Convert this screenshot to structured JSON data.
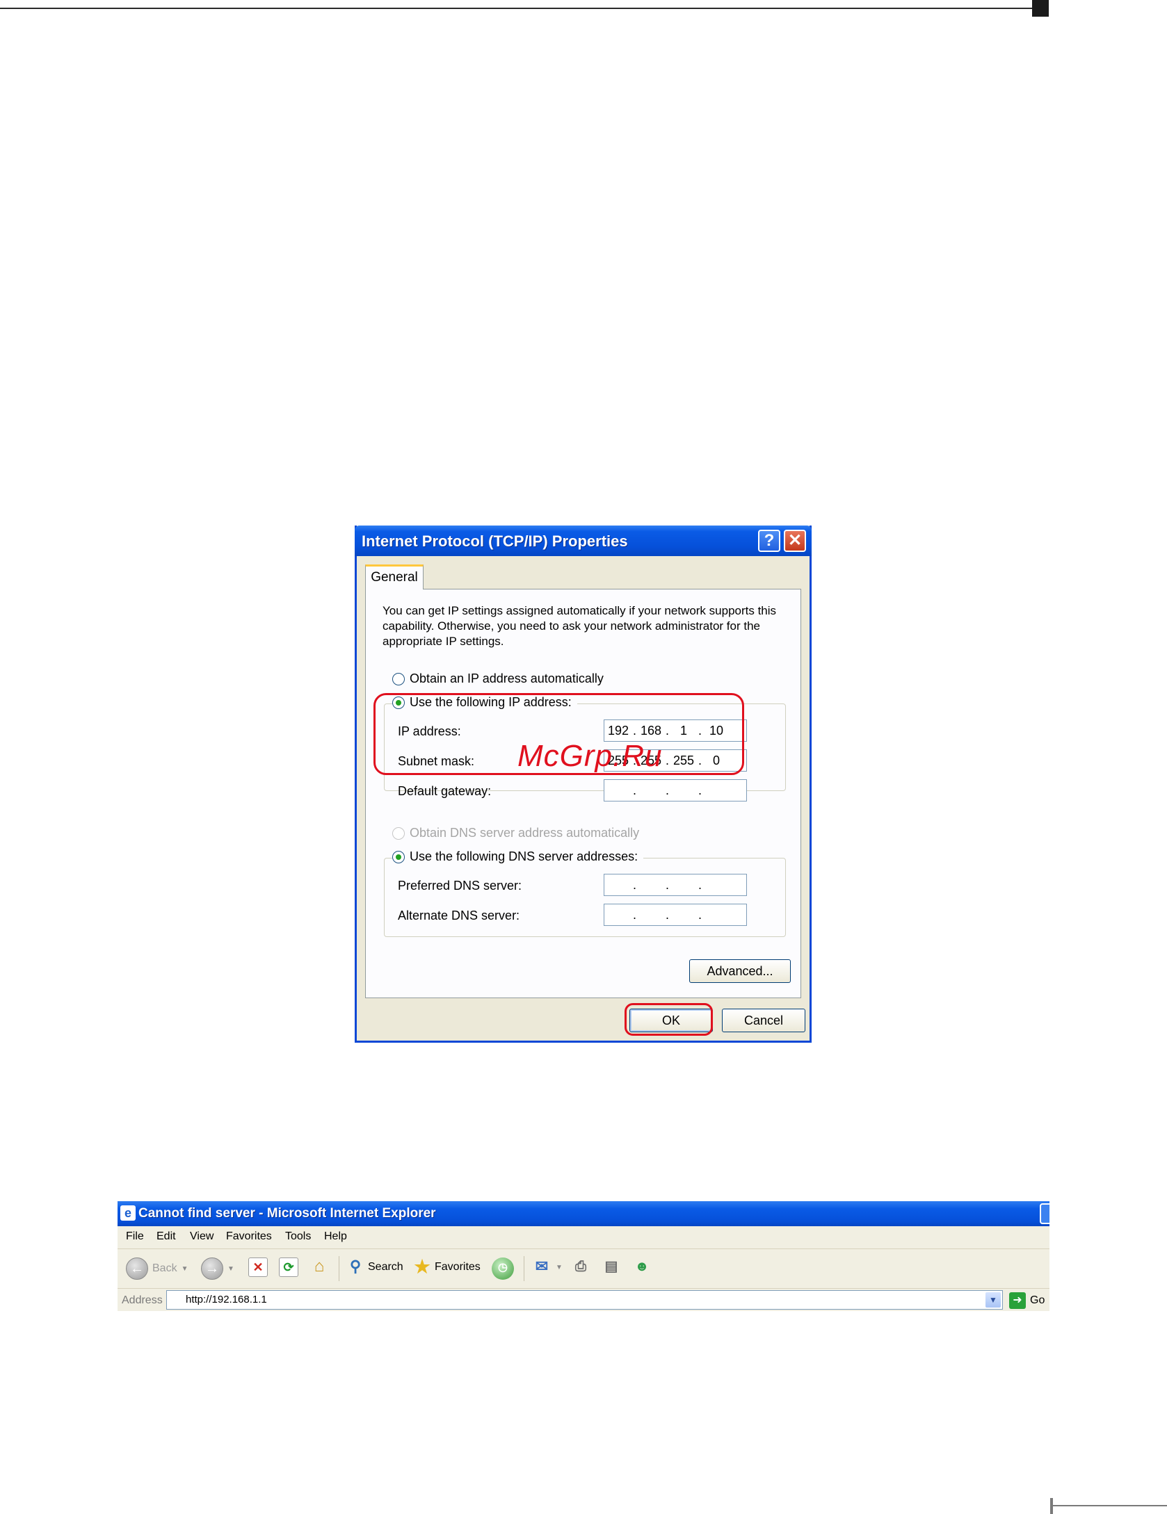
{
  "dialog": {
    "title": "Internet Protocol (TCP/IP) Properties",
    "help_glyph": "?",
    "close_glyph": "✕",
    "tab_general": "General",
    "intro": "You can get IP settings assigned automatically if your network supports this capability. Otherwise, you need to ask your network administrator for the appropriate IP settings.",
    "radio_obtain_ip": "Obtain an IP address automatically",
    "radio_use_ip": "Use the following IP address:",
    "ip_label": "IP address:",
    "ip_value": [
      "192",
      "168",
      "1",
      "10"
    ],
    "subnet_label": "Subnet mask:",
    "subnet_value": [
      "255",
      "255",
      "255",
      "0"
    ],
    "gateway_label": "Default gateway:",
    "gateway_value": [
      "",
      "",
      "",
      ""
    ],
    "radio_obtain_dns": "Obtain DNS server address automatically",
    "radio_use_dns": "Use the following DNS server addresses:",
    "preferred_dns_label": "Preferred DNS server:",
    "preferred_dns_value": [
      "",
      "",
      "",
      ""
    ],
    "alternate_dns_label": "Alternate DNS server:",
    "alternate_dns_value": [
      "",
      "",
      "",
      ""
    ],
    "advanced_button": "Advanced...",
    "ok_button": "OK",
    "cancel_button": "Cancel",
    "selected_ip_mode": "manual",
    "selected_dns_mode": "manual"
  },
  "highlight_color": "#e0101e",
  "watermark": "McGrp.Ru",
  "browser": {
    "title": "Cannot find server - Microsoft Internet Explorer",
    "menu": [
      "File",
      "Edit",
      "View",
      "Favorites",
      "Tools",
      "Help"
    ],
    "toolbar": {
      "back": "Back",
      "search": "Search",
      "favorites": "Favorites"
    },
    "address_label": "Address",
    "address_value": "http://192.168.1.1",
    "go_label": "Go"
  }
}
